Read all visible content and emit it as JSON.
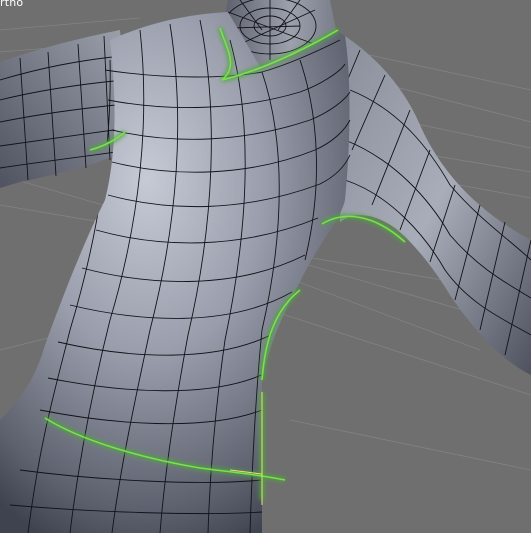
{
  "viewport": {
    "view_label": "rtho",
    "colors": {
      "background": "#6f6f6f",
      "grid_line": "#8a8a8a",
      "mesh_fill_light": "#c3c7d2",
      "mesh_fill_dark": "#474b58",
      "wireframe": "#111318",
      "seam": "#5fd03a",
      "seam_glow": "#3c7a2a",
      "selected_edge": "#e8e070"
    }
  }
}
